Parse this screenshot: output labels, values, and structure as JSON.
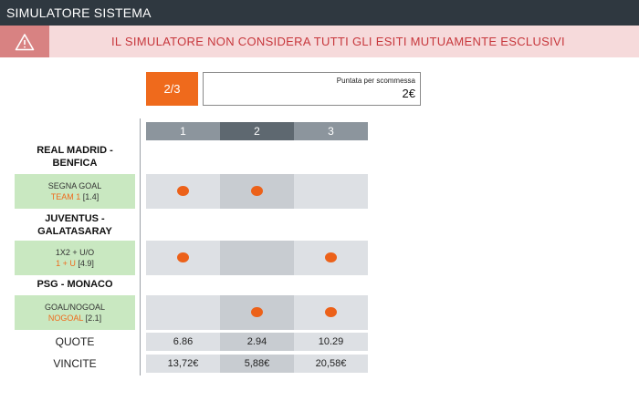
{
  "window": {
    "title": "SIMULATORE SISTEMA"
  },
  "warning": {
    "icon": "warning-triangle-icon",
    "text": "IL SIMULATORE NON CONSIDERA TUTTI GLI ESITI MUTUAMENTE ESCLUSIVI"
  },
  "controls": {
    "count_label": "2/3",
    "stake_label": "Puntata per scommessa",
    "stake_value": "2€"
  },
  "columns": [
    "1",
    "2",
    "3"
  ],
  "matches": [
    {
      "title_line1": "REAL MADRID -",
      "title_line2": "BENFICA",
      "bet_type": "SEGNA GOAL",
      "bet_pick": "TEAM 1",
      "bet_odds": "[1.4]",
      "selected": [
        true,
        true,
        false
      ]
    },
    {
      "title_line1": "JUVENTUS -",
      "title_line2": "GALATASARAY",
      "bet_type": "1X2 + U/O",
      "bet_pick": "1 + U",
      "bet_odds": "[4.9]",
      "selected": [
        true,
        false,
        true
      ]
    },
    {
      "title_line1": "PSG - MONACO",
      "title_line2": "",
      "bet_type": "GOAL/NOGOAL",
      "bet_pick": "NOGOAL",
      "bet_odds": "[2.1]",
      "selected": [
        false,
        true,
        true
      ]
    }
  ],
  "quote": {
    "label": "QUOTE",
    "values": [
      "6.86",
      "2.94",
      "10.29"
    ]
  },
  "vincite": {
    "label": "VINCITE",
    "values": [
      "13,72€",
      "5,88€",
      "20,58€"
    ]
  },
  "colors": {
    "accent": "#ef6a1c",
    "header": "#2f3840",
    "warning_bg": "#f6dadb",
    "warning_text": "#c7373c",
    "bet_bg": "#c9e8c1"
  }
}
